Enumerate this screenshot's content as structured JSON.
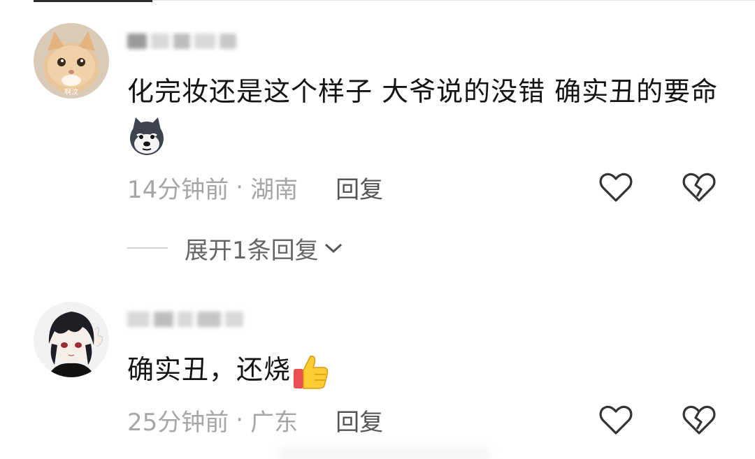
{
  "comments": [
    {
      "avatar_caption": "啊汶",
      "text": "化完妆还是这个样子 大爷说的没错 确实丑的要命",
      "emoji": "husky-emoji",
      "time": "14分钟前",
      "separator": "·",
      "location": "湖南",
      "reply_label": "回复",
      "expand_label": "展开1条回复"
    },
    {
      "avatar_caption": "",
      "text": "确实丑，还烧",
      "emoji": "thumbs-up-emoji",
      "time": "25分钟前",
      "separator": "·",
      "location": "广东",
      "reply_label": "回复"
    }
  ],
  "colors": {
    "meta_text": "#a6a6a6",
    "reply_text": "#555555",
    "icon_stroke": "#333333"
  }
}
